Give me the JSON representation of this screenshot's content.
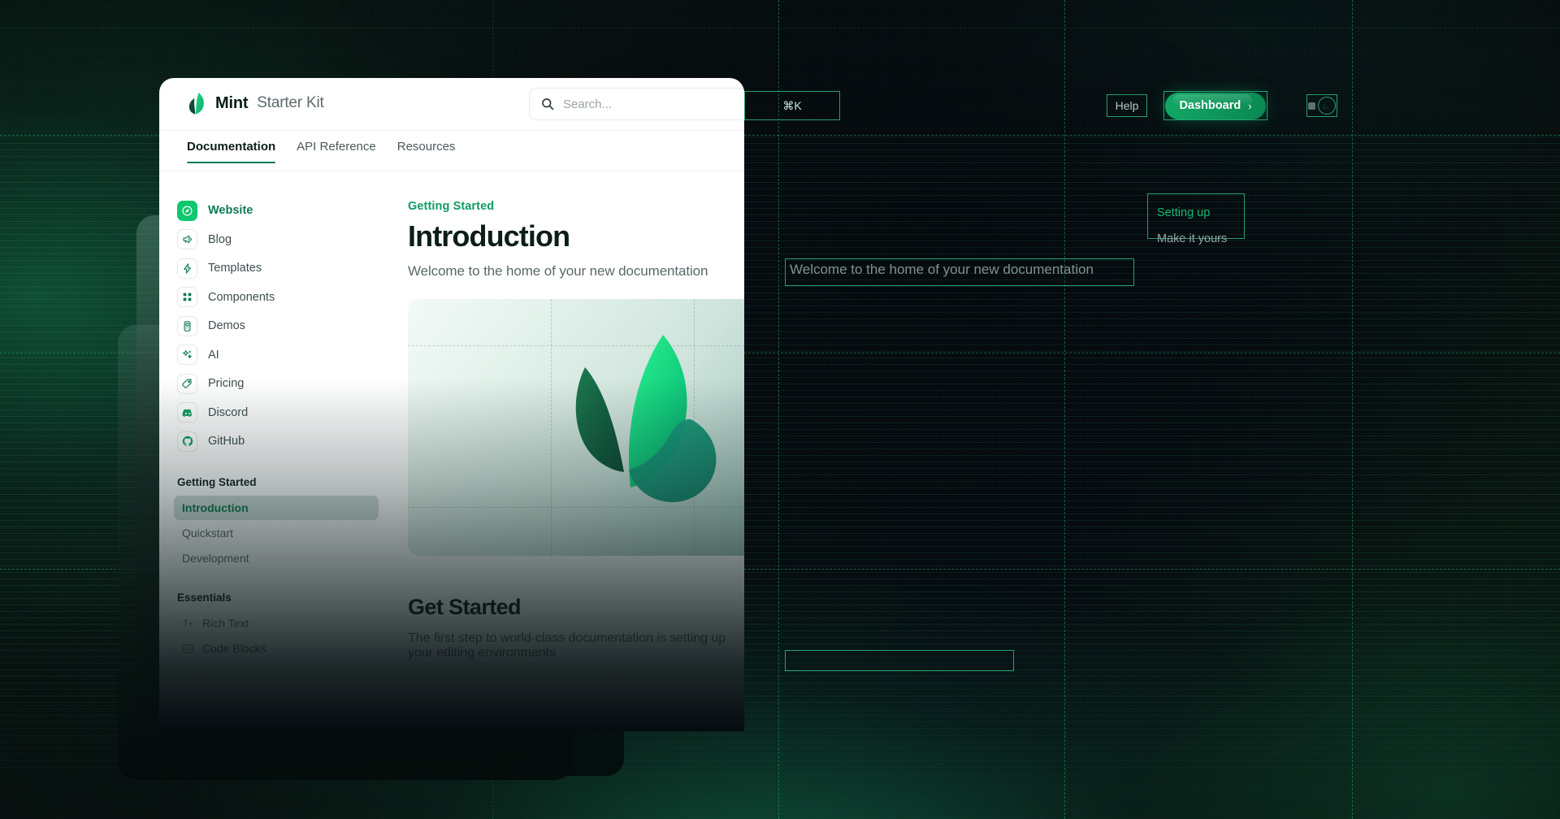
{
  "brand": {
    "name": "Mint",
    "suffix": "Starter Kit",
    "logo_icon": "mint-leaf-logo"
  },
  "search": {
    "placeholder": "Search...",
    "shortcut": "⌘K",
    "icon": "search-icon"
  },
  "header_actions": {
    "help_label": "Help",
    "dashboard_label": "Dashboard",
    "dashboard_chevron": "›",
    "theme_toggle_icon": "moon-icon"
  },
  "tabs": [
    {
      "label": "Documentation",
      "active": true
    },
    {
      "label": "API Reference",
      "active": false
    },
    {
      "label": "Resources",
      "active": false
    }
  ],
  "sidebar": {
    "links": [
      {
        "label": "Website",
        "icon": "compass-icon",
        "active": true
      },
      {
        "label": "Blog",
        "icon": "megaphone-icon",
        "active": false
      },
      {
        "label": "Templates",
        "icon": "bolt-icon",
        "active": false
      },
      {
        "label": "Components",
        "icon": "grid-icon",
        "active": false
      },
      {
        "label": "Demos",
        "icon": "device-icon",
        "active": false
      },
      {
        "label": "AI",
        "icon": "sparkles-icon",
        "active": false
      },
      {
        "label": "Pricing",
        "icon": "tag-icon",
        "active": false
      },
      {
        "label": "Discord",
        "icon": "discord-icon",
        "active": false
      },
      {
        "label": "GitHub",
        "icon": "github-icon",
        "active": false
      }
    ],
    "sections": [
      {
        "title": "Getting Started",
        "items": [
          {
            "label": "Introduction",
            "active": true
          },
          {
            "label": "Quickstart",
            "active": false
          },
          {
            "label": "Development",
            "active": false
          }
        ]
      },
      {
        "title": "Essentials",
        "items": [
          {
            "label": "Rich Text",
            "icon": "text-format-icon",
            "active": false
          },
          {
            "label": "Code Blocks",
            "icon": "code-block-icon",
            "active": false
          }
        ]
      }
    ]
  },
  "main": {
    "eyebrow": "Getting Started",
    "title": "Introduction",
    "lede": "Welcome to the home of your new documentation",
    "hero_icon": "mint-leaf-hero",
    "section_title": "Get Started",
    "section_body": "The first step to world-class documentation is setting up your editing environments"
  },
  "toc": [
    {
      "label": "Setting up",
      "active": true
    },
    {
      "label": "Make it yours",
      "active": false
    }
  ],
  "colors": {
    "brand_green": "#0ec76e",
    "accent_green": "#0f7a52",
    "overlay_outline": "#2ec486",
    "dark_bg": "#05100d",
    "text_dark": "#0c1d1a",
    "text_muted": "#5a686b"
  }
}
